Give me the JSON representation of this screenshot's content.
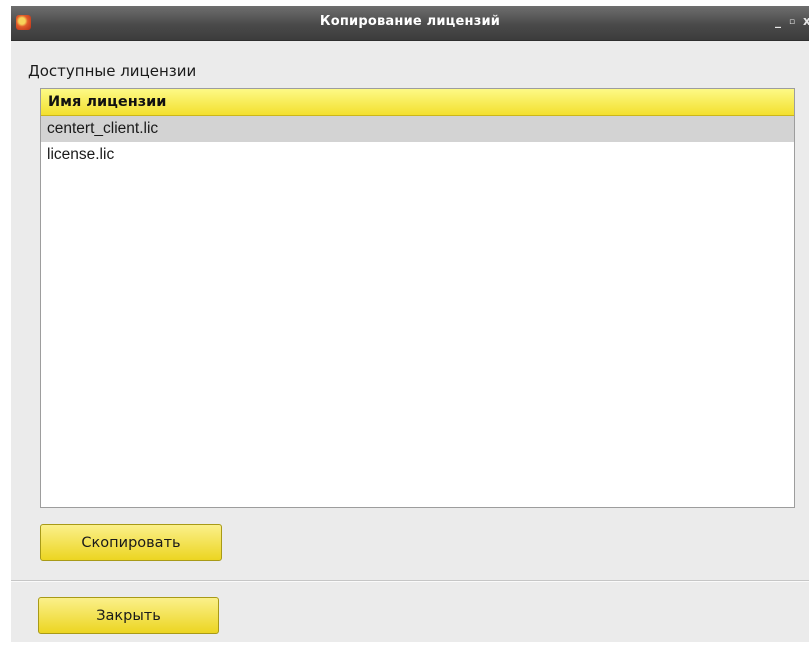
{
  "window": {
    "title": "Копирование лицензий",
    "controls": {
      "minimize": "_",
      "maximize": "▫",
      "close": "x"
    }
  },
  "section_label": "Доступные лицензии",
  "license_list": {
    "column_header": "Имя лицензии",
    "items": [
      {
        "name": "centert_client.lic",
        "selected": true
      },
      {
        "name": "license.lic",
        "selected": false
      }
    ]
  },
  "buttons": {
    "copy_label": "Скопировать",
    "close_label": "Закрыть"
  },
  "colors": {
    "header_accent": "#f3e02e",
    "button_accent": "#ecd521",
    "selection": "#d3d3d3",
    "titlebar": "#4a4a4a"
  },
  "icons": {
    "app": "app-icon"
  }
}
